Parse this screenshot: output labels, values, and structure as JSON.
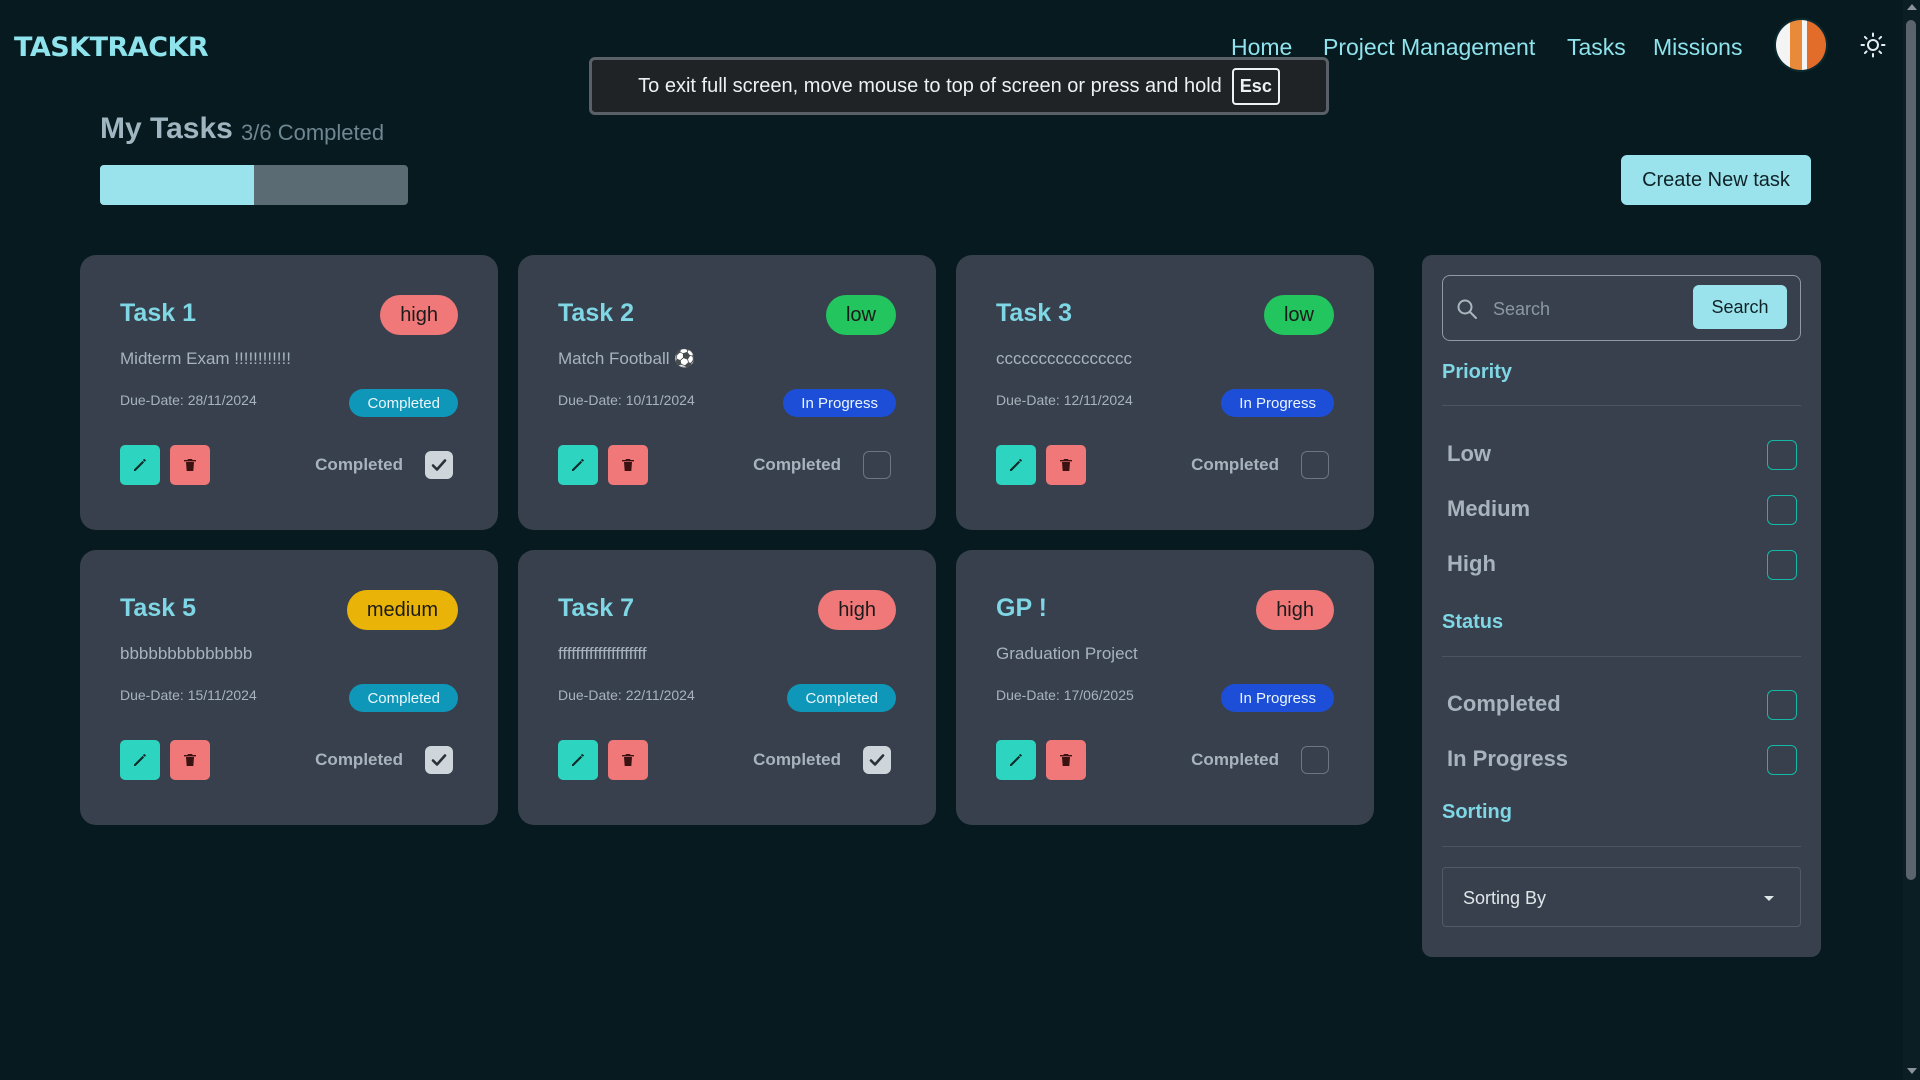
{
  "app": {
    "logo": "TASKTRACKR"
  },
  "nav": {
    "items": [
      "Home",
      "Project Management",
      "Tasks",
      "Missions"
    ]
  },
  "fullscreen_notice": {
    "text": "To exit full screen, move mouse to top of screen or press and hold",
    "key": "Esc"
  },
  "header": {
    "title": "My Tasks",
    "completed_text": "3/6 Completed",
    "progress": 0.5,
    "create_button": "Create New task"
  },
  "tasks": [
    {
      "title": "Task 1",
      "priority": "high",
      "description": "Midterm Exam !!!!!!!!!!!!",
      "due": "Due-Date: 28/11/2024",
      "status": "Completed",
      "complete_label": "Completed",
      "checked": true
    },
    {
      "title": "Task 2",
      "priority": "low",
      "description": "Match Football ⚽",
      "due": "Due-Date: 10/11/2024",
      "status": "In Progress",
      "complete_label": "Completed",
      "checked": false
    },
    {
      "title": "Task 3",
      "priority": "low",
      "description": "cccccccccccccccc",
      "due": "Due-Date: 12/11/2024",
      "status": "In Progress",
      "complete_label": "Completed",
      "checked": false
    },
    {
      "title": "Task 5",
      "priority": "medium",
      "description": "bbbbbbbbbbbbbb",
      "due": "Due-Date: 15/11/2024",
      "status": "Completed",
      "complete_label": "Completed",
      "checked": true
    },
    {
      "title": "Task 7",
      "priority": "high",
      "description": "ffffffffffffffffffff",
      "due": "Due-Date: 22/11/2024",
      "status": "Completed",
      "complete_label": "Completed",
      "checked": true
    },
    {
      "title": "GP !",
      "priority": "high",
      "description": "Graduation Project",
      "due": "Due-Date: 17/06/2025",
      "status": "In Progress",
      "complete_label": "Completed",
      "checked": false
    }
  ],
  "filters": {
    "search_placeholder": "Search",
    "search_button": "Search",
    "priority_title": "Priority",
    "priority_options": [
      "Low",
      "Medium",
      "High"
    ],
    "status_title": "Status",
    "status_options": [
      "Completed",
      "In Progress"
    ],
    "sorting_title": "Sorting",
    "sorting_value": "Sorting By"
  },
  "colors": {
    "accent": "#9be3ec",
    "priority_high": "#f07878",
    "priority_low": "#22c55e",
    "priority_medium": "#eab308",
    "status_completed": "#0e97b8",
    "status_in_progress": "#1d4ed8"
  }
}
